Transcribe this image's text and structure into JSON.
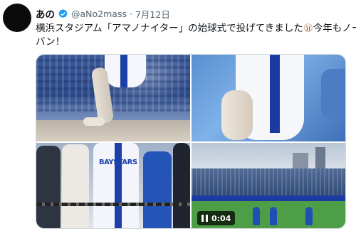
{
  "tweet": {
    "display_name": "あの",
    "handle": "@aNo2mass",
    "separator": "·",
    "date": "7月12日",
    "text_line_1_before": "横浜スタジアム「アマノナイター」の始球式で投げてきました",
    "text_line_1_after": "今年もノー",
    "text_line_2": "バン！",
    "emoji": "baseball-emoji"
  },
  "media": {
    "jersey_text": "BAYSTARS",
    "video": {
      "state": "playing",
      "time": "0:04"
    }
  },
  "colors": {
    "verified_blue": "#1d9bf0",
    "text_primary": "#0f1419",
    "text_secondary": "#536471",
    "border": "#cfd9de"
  }
}
